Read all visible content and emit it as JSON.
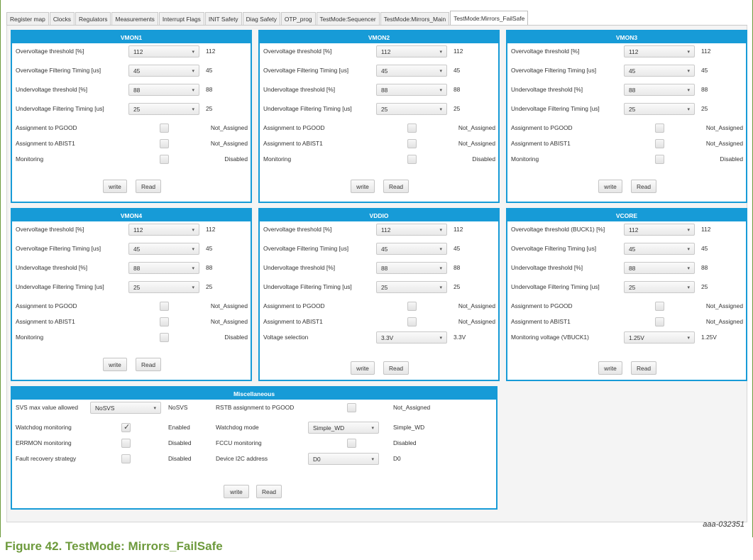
{
  "tabs": [
    "Register map",
    "Clocks",
    "Regulators",
    "Measurements",
    "Interrupt Flags",
    "INIT Safety",
    "Diag Safety",
    "OTP_prog",
    "TestMode:Sequencer",
    "TestMode:Mirrors_Main",
    "TestMode:Mirrors_FailSafe"
  ],
  "active_tab": "TestMode:Mirrors_FailSafe",
  "buttons": {
    "write": "write",
    "read": "Read"
  },
  "panels": [
    {
      "title": "VMON1",
      "rows": [
        {
          "label": "Overvoltage threshold [%]",
          "type": "combo",
          "value": "112",
          "readback": "112"
        },
        {
          "label": "Overvoltage Filtering Timing [us]",
          "type": "combo",
          "value": "45",
          "readback": "45"
        },
        {
          "label": "Undervoltage threshold [%]",
          "type": "combo",
          "value": "88",
          "readback": "88"
        },
        {
          "label": "Undervoltage Filtering Timing [us]",
          "type": "combo",
          "value": "25",
          "readback": "25"
        },
        {
          "label": "Assignment to PGOOD",
          "type": "check",
          "checked": false,
          "readback": "Not_Assigned"
        },
        {
          "label": "Assignment to ABIST1",
          "type": "check",
          "checked": false,
          "readback": "Not_Assigned"
        },
        {
          "label": "Monitoring",
          "type": "check",
          "checked": false,
          "readback": "Disabled"
        }
      ]
    },
    {
      "title": "VMON2",
      "rows": [
        {
          "label": "Overvoltage threshold [%]",
          "type": "combo",
          "value": "112",
          "readback": "112"
        },
        {
          "label": "Overvoltage Filtering Timing [us]",
          "type": "combo",
          "value": "45",
          "readback": "45"
        },
        {
          "label": "Undervoltage threshold [%]",
          "type": "combo",
          "value": "88",
          "readback": "88"
        },
        {
          "label": "Undervoltage Filtering Timing [us]",
          "type": "combo",
          "value": "25",
          "readback": "25"
        },
        {
          "label": "Assignment to PGOOD",
          "type": "check",
          "checked": false,
          "readback": "Not_Assigned"
        },
        {
          "label": "Assignment to ABIST1",
          "type": "check",
          "checked": false,
          "readback": "Not_Assigned"
        },
        {
          "label": "Monitoring",
          "type": "check",
          "checked": false,
          "readback": "Disabled"
        }
      ]
    },
    {
      "title": "VMON3",
      "rows": [
        {
          "label": "Overvoltage threshold [%]",
          "type": "combo",
          "value": "112",
          "readback": "112"
        },
        {
          "label": "Overvoltage Filtering Timing [us]",
          "type": "combo",
          "value": "45",
          "readback": "45"
        },
        {
          "label": "Undervoltage threshold [%]",
          "type": "combo",
          "value": "88",
          "readback": "88"
        },
        {
          "label": "Undervoltage Filtering Timing [us]",
          "type": "combo",
          "value": "25",
          "readback": "25"
        },
        {
          "label": "Assignment to PGOOD",
          "type": "check",
          "checked": false,
          "readback": "Not_Assigned"
        },
        {
          "label": "Assignment to ABIST1",
          "type": "check",
          "checked": false,
          "readback": "Not_Assigned"
        },
        {
          "label": "Monitoring",
          "type": "check",
          "checked": false,
          "readback": "Disabled"
        }
      ]
    },
    {
      "title": "VMON4",
      "rows": [
        {
          "label": "Overvoltage threshold [%]",
          "type": "combo",
          "value": "112",
          "readback": "112"
        },
        {
          "label": "Overvoltage Filtering Timing [us]",
          "type": "combo",
          "value": "45",
          "readback": "45"
        },
        {
          "label": "Undervoltage threshold [%]",
          "type": "combo",
          "value": "88",
          "readback": "88"
        },
        {
          "label": "Undervoltage Filtering Timing [us]",
          "type": "combo",
          "value": "25",
          "readback": "25"
        },
        {
          "label": "Assignment to PGOOD",
          "type": "check",
          "checked": false,
          "readback": "Not_Assigned"
        },
        {
          "label": "Assignment to ABIST1",
          "type": "check",
          "checked": false,
          "readback": "Not_Assigned"
        },
        {
          "label": "Monitoring",
          "type": "check",
          "checked": false,
          "readback": "Disabled"
        }
      ]
    },
    {
      "title": "VDDIO",
      "rows": [
        {
          "label": "Overvoltage threshold [%]",
          "type": "combo",
          "value": "112",
          "readback": "112"
        },
        {
          "label": "Overvoltage Filtering Timing [us]",
          "type": "combo",
          "value": "45",
          "readback": "45"
        },
        {
          "label": "Undervoltage threshold [%]",
          "type": "combo",
          "value": "88",
          "readback": "88"
        },
        {
          "label": "Undervoltage Filtering Timing [us]",
          "type": "combo",
          "value": "25",
          "readback": "25"
        },
        {
          "label": "Assignment to PGOOD",
          "type": "check",
          "checked": false,
          "readback": "Not_Assigned"
        },
        {
          "label": "Assignment to ABIST1",
          "type": "check",
          "checked": false,
          "readback": "Not_Assigned"
        },
        {
          "label": "Voltage selection",
          "type": "combo",
          "value": "3.3V",
          "readback": "3.3V"
        }
      ]
    },
    {
      "title": "VCORE",
      "rows": [
        {
          "label": "Overvoltage threshold (BUCK1) [%]",
          "type": "combo",
          "value": "112",
          "readback": "112"
        },
        {
          "label": "Overvoltage Filtering Timing [us]",
          "type": "combo",
          "value": "45",
          "readback": "45"
        },
        {
          "label": "Undervoltage threshold [%]",
          "type": "combo",
          "value": "88",
          "readback": "88"
        },
        {
          "label": "Undervoltage Filtering Timing [us]",
          "type": "combo",
          "value": "25",
          "readback": "25"
        },
        {
          "label": "Assignment to PGOOD",
          "type": "check",
          "checked": false,
          "readback": "Not_Assigned"
        },
        {
          "label": "Assignment to ABIST1",
          "type": "check",
          "checked": false,
          "readback": "Not_Assigned"
        },
        {
          "label": "Monitoring voltage (VBUCK1)",
          "type": "combo",
          "value": "1.25V",
          "readback": "1.25V"
        }
      ]
    }
  ],
  "misc": {
    "title": "Miscellaneous",
    "left": [
      {
        "label": "SVS max value allowed",
        "type": "combo",
        "value": "NoSVS",
        "readback": "NoSVS"
      },
      {
        "label": "Watchdog monitoring",
        "type": "check",
        "checked": true,
        "readback": "Enabled"
      },
      {
        "label": "ERRMON monitoring",
        "type": "check",
        "checked": false,
        "readback": "Disabled"
      },
      {
        "label": "Fault recovery strategy",
        "type": "check",
        "checked": false,
        "readback": "Disabled"
      }
    ],
    "right": [
      {
        "label": "RSTB assignment to PGOOD",
        "type": "check",
        "checked": false,
        "readback": "Not_Assigned"
      },
      {
        "label": "Watchdog mode",
        "type": "combo",
        "value": "Simple_WD",
        "readback": "Simple_WD"
      },
      {
        "label": "FCCU monitoring",
        "type": "check",
        "checked": false,
        "readback": "Disabled"
      },
      {
        "label": "Device I2C address",
        "type": "combo",
        "value": "D0",
        "readback": "D0"
      }
    ]
  },
  "caption_id": "aaa-032351",
  "figure_caption": "Figure 42. TestMode: Mirrors_FailSafe",
  "colors": {
    "panel_header": "#179bd7",
    "figure_caption": "#6d9a3c"
  }
}
